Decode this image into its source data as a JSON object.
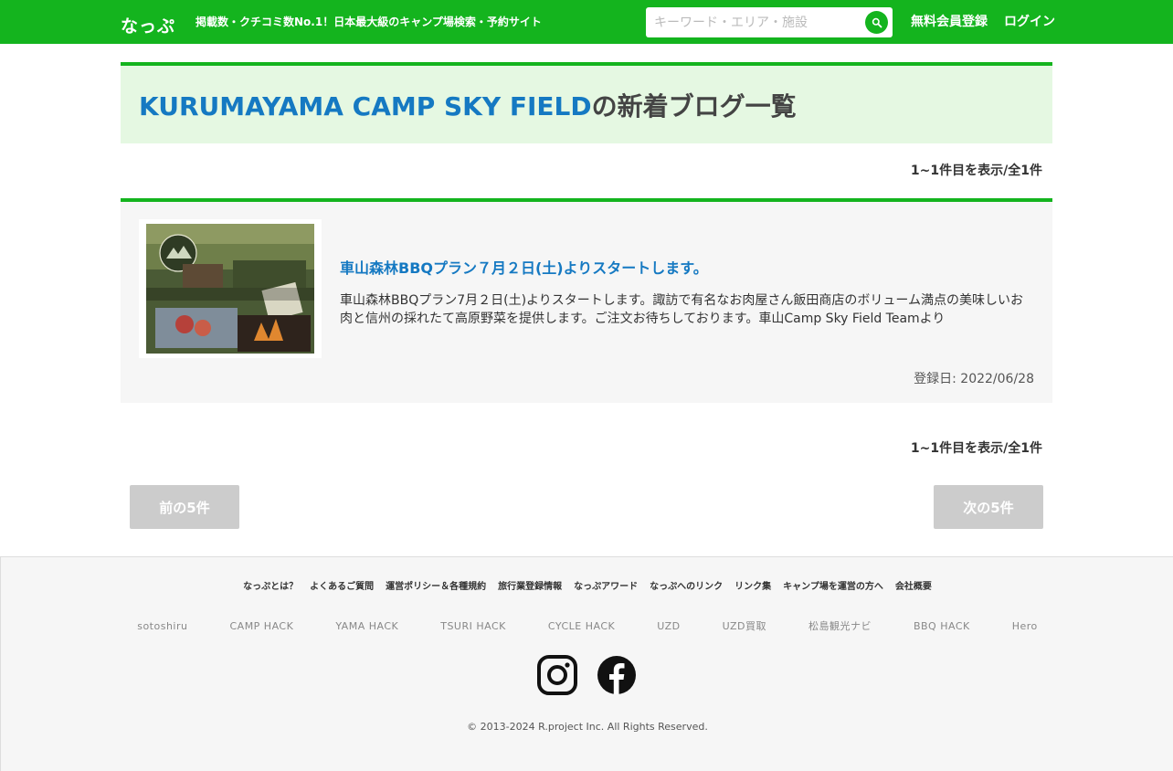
{
  "header": {
    "logo": "なっぷ",
    "tagline": "掲載数・クチコミ数No.1！日本最大級のキャンプ場検索・予約サイト",
    "search_placeholder": "キーワード・エリア・施設",
    "search_icon": "search-icon",
    "register_label": "無料会員登録",
    "login_label": "ログイン",
    "brand_color": "#14b41e"
  },
  "page": {
    "title_name": "KURUMAYAMA CAMP SKY FIELD",
    "title_suffix": "の新着ブログ一覧",
    "count_top": "1~1件目を表示/全1件",
    "count_bottom": "1~1件目を表示/全1件"
  },
  "posts": [
    {
      "thumbnail_alt": "車山森林BBQプラン写真",
      "title": "車山森林BBQプラン７月２日(土)よりスタートします。",
      "excerpt": "車山森林BBQプラン7月２日(土)よりスタートします。諏訪で有名なお肉屋さん飯田商店のボリューム満点の美味しいお肉と信州の採れたて高原野菜を提供します。ご注文お待ちしております。車山Camp Sky Field Teamより",
      "date": "登録日: 2022/06/28"
    }
  ],
  "pagination": {
    "prev_label": "前の5件",
    "next_label": "次の5件"
  },
  "footer": {
    "nav": [
      "なっぷとは？",
      "よくあるご質問",
      "運営ポリシー＆各種規約",
      "旅行業登録情報",
      "なっぷアワード",
      "なっぷへのリンク",
      "リンク集",
      "キャンプ場を運営の方へ",
      "会社概要"
    ],
    "partners": [
      "sotoshiru",
      "CAMP HACK",
      "YAMA HACK",
      "TSURI HACK",
      "CYCLE HACK",
      "UZD",
      "UZD買取",
      "松島観光ナビ",
      "BBQ HACK",
      "Hero"
    ],
    "social": [
      "instagram-icon",
      "facebook-icon"
    ],
    "copyright": "© 2013-2024 R.project Inc. All Rights Reserved."
  }
}
